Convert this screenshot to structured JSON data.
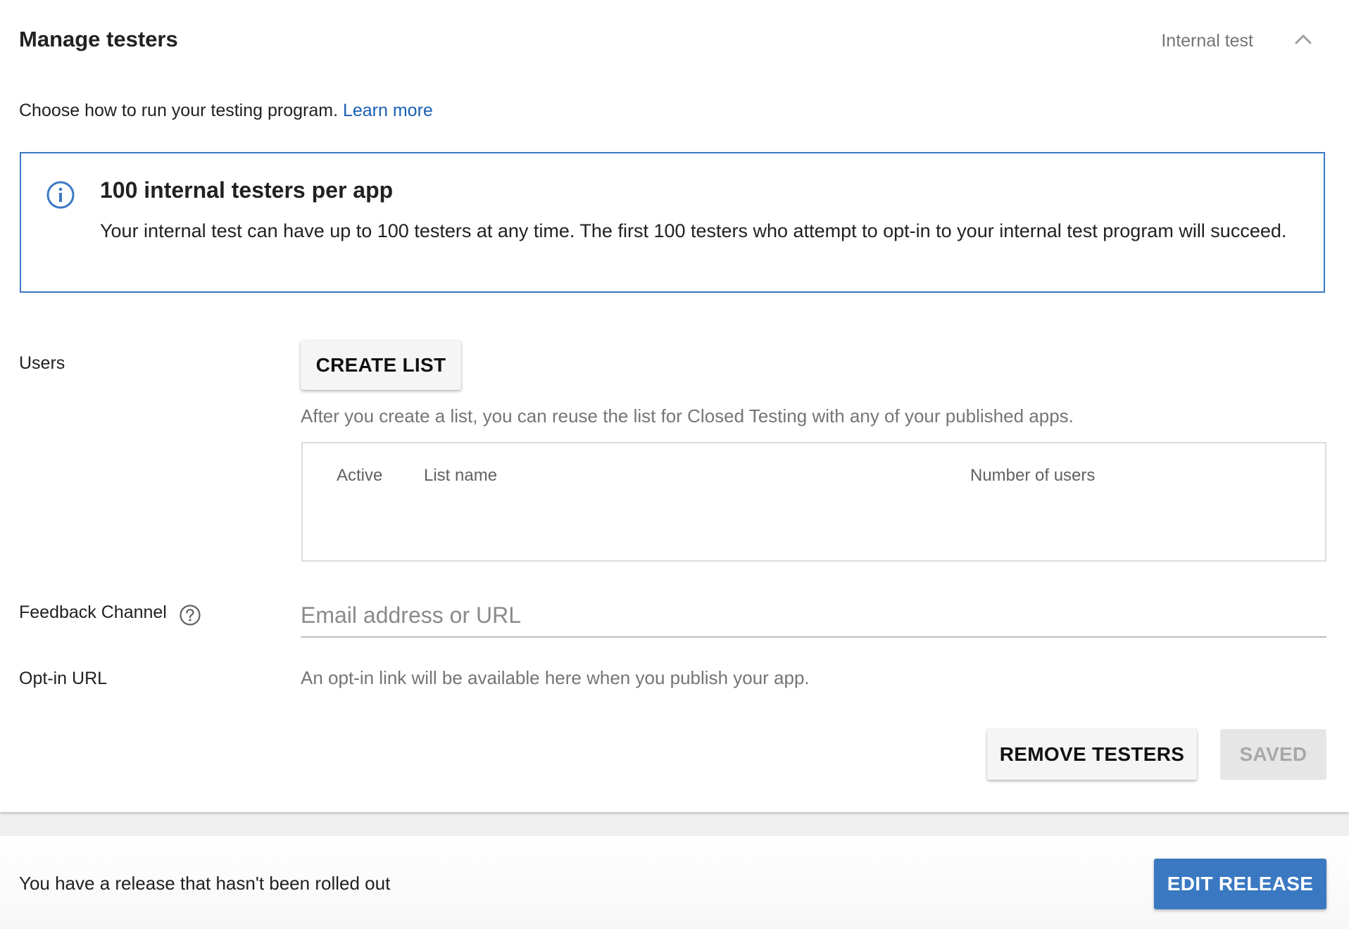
{
  "header": {
    "title": "Manage testers",
    "track_label": "Internal test",
    "collapse_icon": "chevron-up-icon"
  },
  "intro": {
    "text": "Choose how to run your testing program.",
    "link": "Learn more"
  },
  "info_box": {
    "icon": "info-icon",
    "title": "100 internal testers per app",
    "body": "Your internal test can have up to 100 testers at any time. The first 100 testers who attempt to opt-in to your internal test program will succeed."
  },
  "users": {
    "label": "Users",
    "create_list_label": "CREATE LIST",
    "hint": "After you create a list, you can reuse the list for Closed Testing with any of your published apps.",
    "table": {
      "columns": [
        "Active",
        "List name",
        "Number of users"
      ],
      "rows": []
    }
  },
  "feedback": {
    "label": "Feedback Channel",
    "help_icon": "help-circle-icon",
    "placeholder": "Email address or URL",
    "value": ""
  },
  "optin": {
    "label": "Opt-in URL",
    "text": "An opt-in link will be available here when you publish your app."
  },
  "actions": {
    "remove_testers_label": "REMOVE TESTERS",
    "saved_label": "SAVED"
  },
  "footer": {
    "text": "You have a release that hasn't been rolled out",
    "edit_release_label": "EDIT RELEASE"
  },
  "colors": {
    "accent": "#3a78c2",
    "link": "#1a5fb4",
    "info_border": "#3b78c4"
  }
}
